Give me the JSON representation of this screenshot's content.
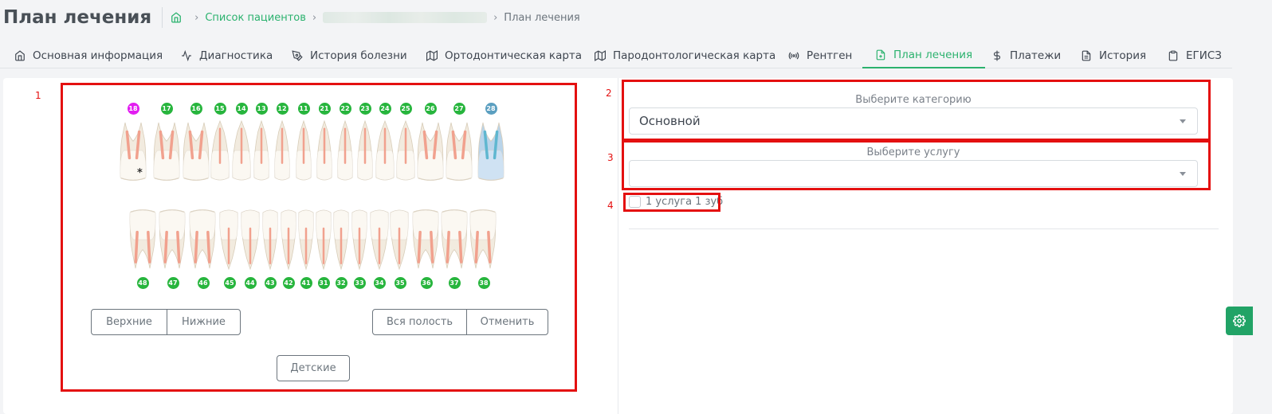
{
  "header": {
    "title": "План лечения",
    "breadcrumbs": [
      "Список пациентов",
      "План лечения"
    ]
  },
  "tabs": [
    {
      "label": "Основная информация",
      "icon": "home-icon",
      "active": false
    },
    {
      "label": "Диагностика",
      "icon": "activity-icon",
      "active": false
    },
    {
      "label": "История болезни",
      "icon": "pen-tool-icon",
      "active": false
    },
    {
      "label": "Ортодонтическая карта",
      "icon": "map-icon",
      "active": false
    },
    {
      "label": "Пародонтологическая карта",
      "icon": "map-icon",
      "active": false
    },
    {
      "label": "Рентген",
      "icon": "radio-icon",
      "active": false
    },
    {
      "label": "План лечения",
      "icon": "file-plus-icon",
      "active": true
    },
    {
      "label": "Платежи",
      "icon": "dollar-icon",
      "active": false
    },
    {
      "label": "История",
      "icon": "file-text-icon",
      "active": false
    },
    {
      "label": "ЕГИСЗ",
      "icon": "clipboard-icon",
      "active": false
    }
  ],
  "annotations": [
    "1",
    "2",
    "3",
    "4"
  ],
  "teeth": {
    "upper": [
      {
        "num": "18",
        "color": "#e21df1"
      },
      {
        "num": "17",
        "color": "#27b53d"
      },
      {
        "num": "16",
        "color": "#27b53d"
      },
      {
        "num": "15",
        "color": "#27b53d"
      },
      {
        "num": "14",
        "color": "#27b53d"
      },
      {
        "num": "13",
        "color": "#27b53d"
      },
      {
        "num": "12",
        "color": "#27b53d"
      },
      {
        "num": "11",
        "color": "#27b53d"
      },
      {
        "num": "21",
        "color": "#27b53d"
      },
      {
        "num": "22",
        "color": "#27b53d"
      },
      {
        "num": "23",
        "color": "#27b53d"
      },
      {
        "num": "24",
        "color": "#27b53d"
      },
      {
        "num": "25",
        "color": "#27b53d"
      },
      {
        "num": "26",
        "color": "#27b53d"
      },
      {
        "num": "27",
        "color": "#27b53d"
      },
      {
        "num": "28",
        "color": "#5b9fc0"
      }
    ],
    "lower": [
      "48",
      "47",
      "46",
      "45",
      "44",
      "43",
      "42",
      "41",
      "31",
      "32",
      "33",
      "34",
      "35",
      "36",
      "37",
      "38"
    ],
    "marker_18": "*"
  },
  "jaw_buttons": {
    "upper": "Верхние",
    "lower": "Нижние",
    "all": "Вся полость",
    "cancel": "Отменить",
    "kids": "Детские"
  },
  "category": {
    "label": "Выберите категорию",
    "value": "Основной"
  },
  "service": {
    "label": "Выберите услугу",
    "value": ""
  },
  "one_service_checkbox": {
    "label": "1 услуга 1 зуб",
    "checked": false
  }
}
